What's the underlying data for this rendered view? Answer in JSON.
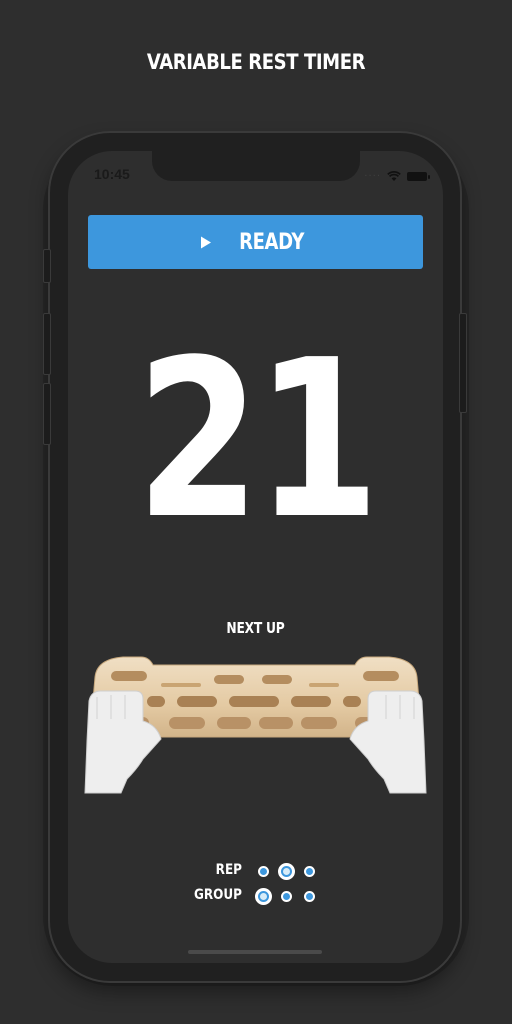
{
  "promo": {
    "title": "VARIABLE REST TIMER"
  },
  "status_bar": {
    "time": "10:45",
    "signal_icon": "cellular-signal-icon",
    "wifi_icon": "wifi-icon",
    "battery_icon": "battery-icon"
  },
  "ready_button": {
    "label": "READY",
    "icon": "play-icon",
    "color": "#3d97dd"
  },
  "timer": {
    "value": "21"
  },
  "next_up": {
    "label": "NEXT UP",
    "illustration": "hangboard-with-hands"
  },
  "selector": {
    "rep": {
      "label": "REP",
      "dot_count": 3,
      "selected_index": 1
    },
    "group": {
      "label": "GROUP",
      "dot_count": 3,
      "selected_index": 0
    }
  },
  "colors": {
    "background": "#2e2e2e",
    "accent": "#3d97dd",
    "text": "#ffffff"
  }
}
